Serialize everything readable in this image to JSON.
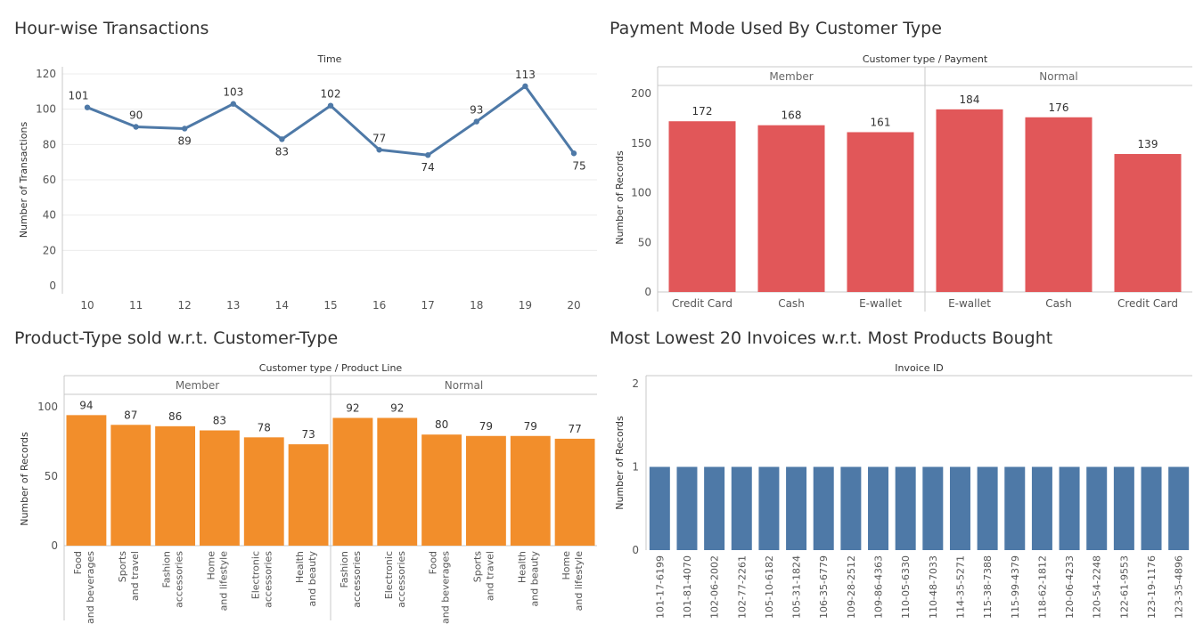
{
  "colors": {
    "line": "#4e79a7",
    "red": "#e15759",
    "orange": "#f28e2b",
    "blue": "#4e79a7"
  },
  "chart_data": [
    {
      "id": "hour",
      "type": "line",
      "title": "Hour-wise Transactions",
      "header": "Time",
      "ylabel": "Number of Transactions",
      "x": [
        10,
        11,
        12,
        13,
        14,
        15,
        16,
        17,
        18,
        19,
        20
      ],
      "values": [
        101,
        90,
        89,
        103,
        83,
        102,
        77,
        74,
        93,
        113,
        75
      ],
      "ylim": [
        0,
        120
      ],
      "yticks": [
        0,
        20,
        40,
        60,
        80,
        100,
        120
      ]
    },
    {
      "id": "payment",
      "type": "bar",
      "title": "Payment Mode Used By Customer Type",
      "header": "Customer type  /  Payment",
      "ylabel": "Number of Records",
      "groups": [
        {
          "name": "Member",
          "categories": [
            "Credit Card",
            "Cash",
            "E-wallet"
          ],
          "values": [
            172,
            168,
            161
          ]
        },
        {
          "name": "Normal",
          "categories": [
            "E-wallet",
            "Cash",
            "Credit Card"
          ],
          "values": [
            184,
            176,
            139
          ]
        }
      ],
      "ylim": [
        0,
        200
      ],
      "yticks": [
        0,
        50,
        100,
        150,
        200
      ]
    },
    {
      "id": "product",
      "type": "bar",
      "title": "Product-Type sold w.r.t. Customer-Type",
      "header": "Customer type  /  Product Line",
      "ylabel": "Number of Records",
      "groups": [
        {
          "name": "Member",
          "categories": [
            "Food and beverages",
            "Sports and travel",
            "Fashion accessories",
            "Home and lifestyle",
            "Electronic accessories",
            "Health and beauty"
          ],
          "values": [
            94,
            87,
            86,
            83,
            78,
            73
          ]
        },
        {
          "name": "Normal",
          "categories": [
            "Fashion accessories",
            "Electronic accessories",
            "Food and beverages",
            "Sports and travel",
            "Health and beauty",
            "Home and lifestyle"
          ],
          "values": [
            92,
            92,
            80,
            79,
            79,
            77
          ]
        }
      ],
      "ylim": [
        0,
        100
      ],
      "yticks": [
        0,
        50,
        100
      ]
    },
    {
      "id": "invoice",
      "type": "bar",
      "title": "Most Lowest 20 Invoices w.r.t. Most Products Bought",
      "header": "Invoice ID",
      "ylabel": "Number of Records",
      "categories": [
        "101-17-6199",
        "101-81-4070",
        "102-06-2002",
        "102-77-2261",
        "105-10-6182",
        "105-31-1824",
        "106-35-6779",
        "109-28-2512",
        "109-86-4363",
        "110-05-6330",
        "110-48-7033",
        "114-35-5271",
        "115-38-7388",
        "115-99-4379",
        "118-62-1812",
        "120-06-4233",
        "120-54-2248",
        "122-61-9553",
        "123-19-1176",
        "123-35-4896"
      ],
      "values": [
        1,
        1,
        1,
        1,
        1,
        1,
        1,
        1,
        1,
        1,
        1,
        1,
        1,
        1,
        1,
        1,
        1,
        1,
        1,
        1
      ],
      "ylim": [
        0,
        2
      ],
      "yticks": [
        0,
        1,
        2
      ]
    }
  ]
}
